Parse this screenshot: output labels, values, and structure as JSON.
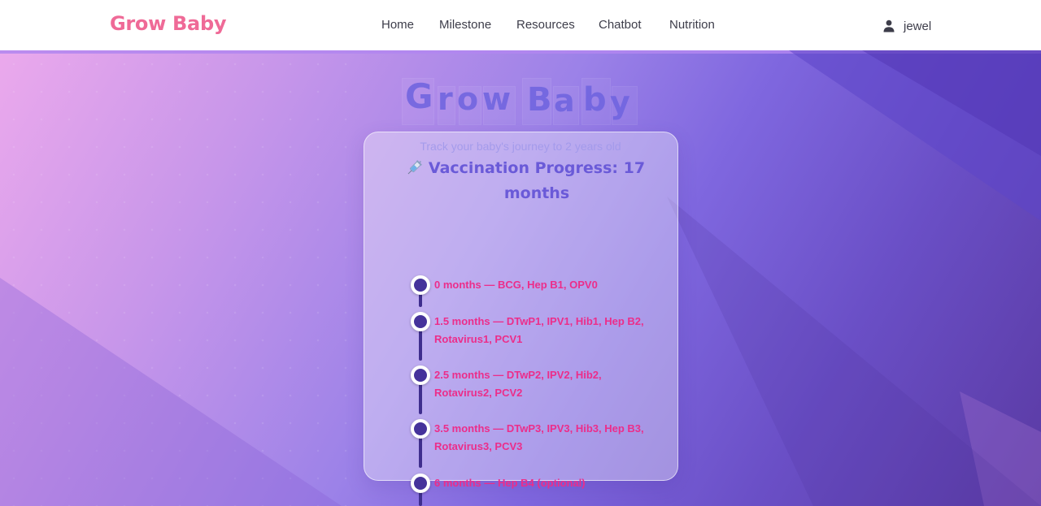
{
  "navbar": {
    "brand": "Grow Baby",
    "links": [
      "Home",
      "Milestone",
      "Resources",
      "Chatbot",
      "Nutrition"
    ],
    "user_name": "jewel",
    "user_icon": "person-icon"
  },
  "hero": {
    "title_letters": [
      "G",
      "r",
      "o",
      "w",
      "B",
      "a",
      "b",
      "y"
    ],
    "subtitle": "Track your baby's journey to 2 years old"
  },
  "vaccination": {
    "icon": "syringe-icon",
    "title": "Vaccination Progress: 17 months",
    "items": [
      "0 months — BCG, Hep B1, OPV0",
      "1.5 months — DTwP1, IPV1, Hib1, Hep B2, Rotavirus1, PCV1",
      "2.5 months — DTwP2, IPV2, Hib2, Rotavirus2, PCV2",
      "3.5 months — DTwP3, IPV3, Hib3, Hep B3, Rotavirus3, PCV3",
      "6 months — Hep B4 (optional)"
    ]
  },
  "colors": {
    "brand": "#ef6a97",
    "accent": "#6a5ad8",
    "item_text": "#ec2d8a",
    "timeline": "#45329b"
  }
}
